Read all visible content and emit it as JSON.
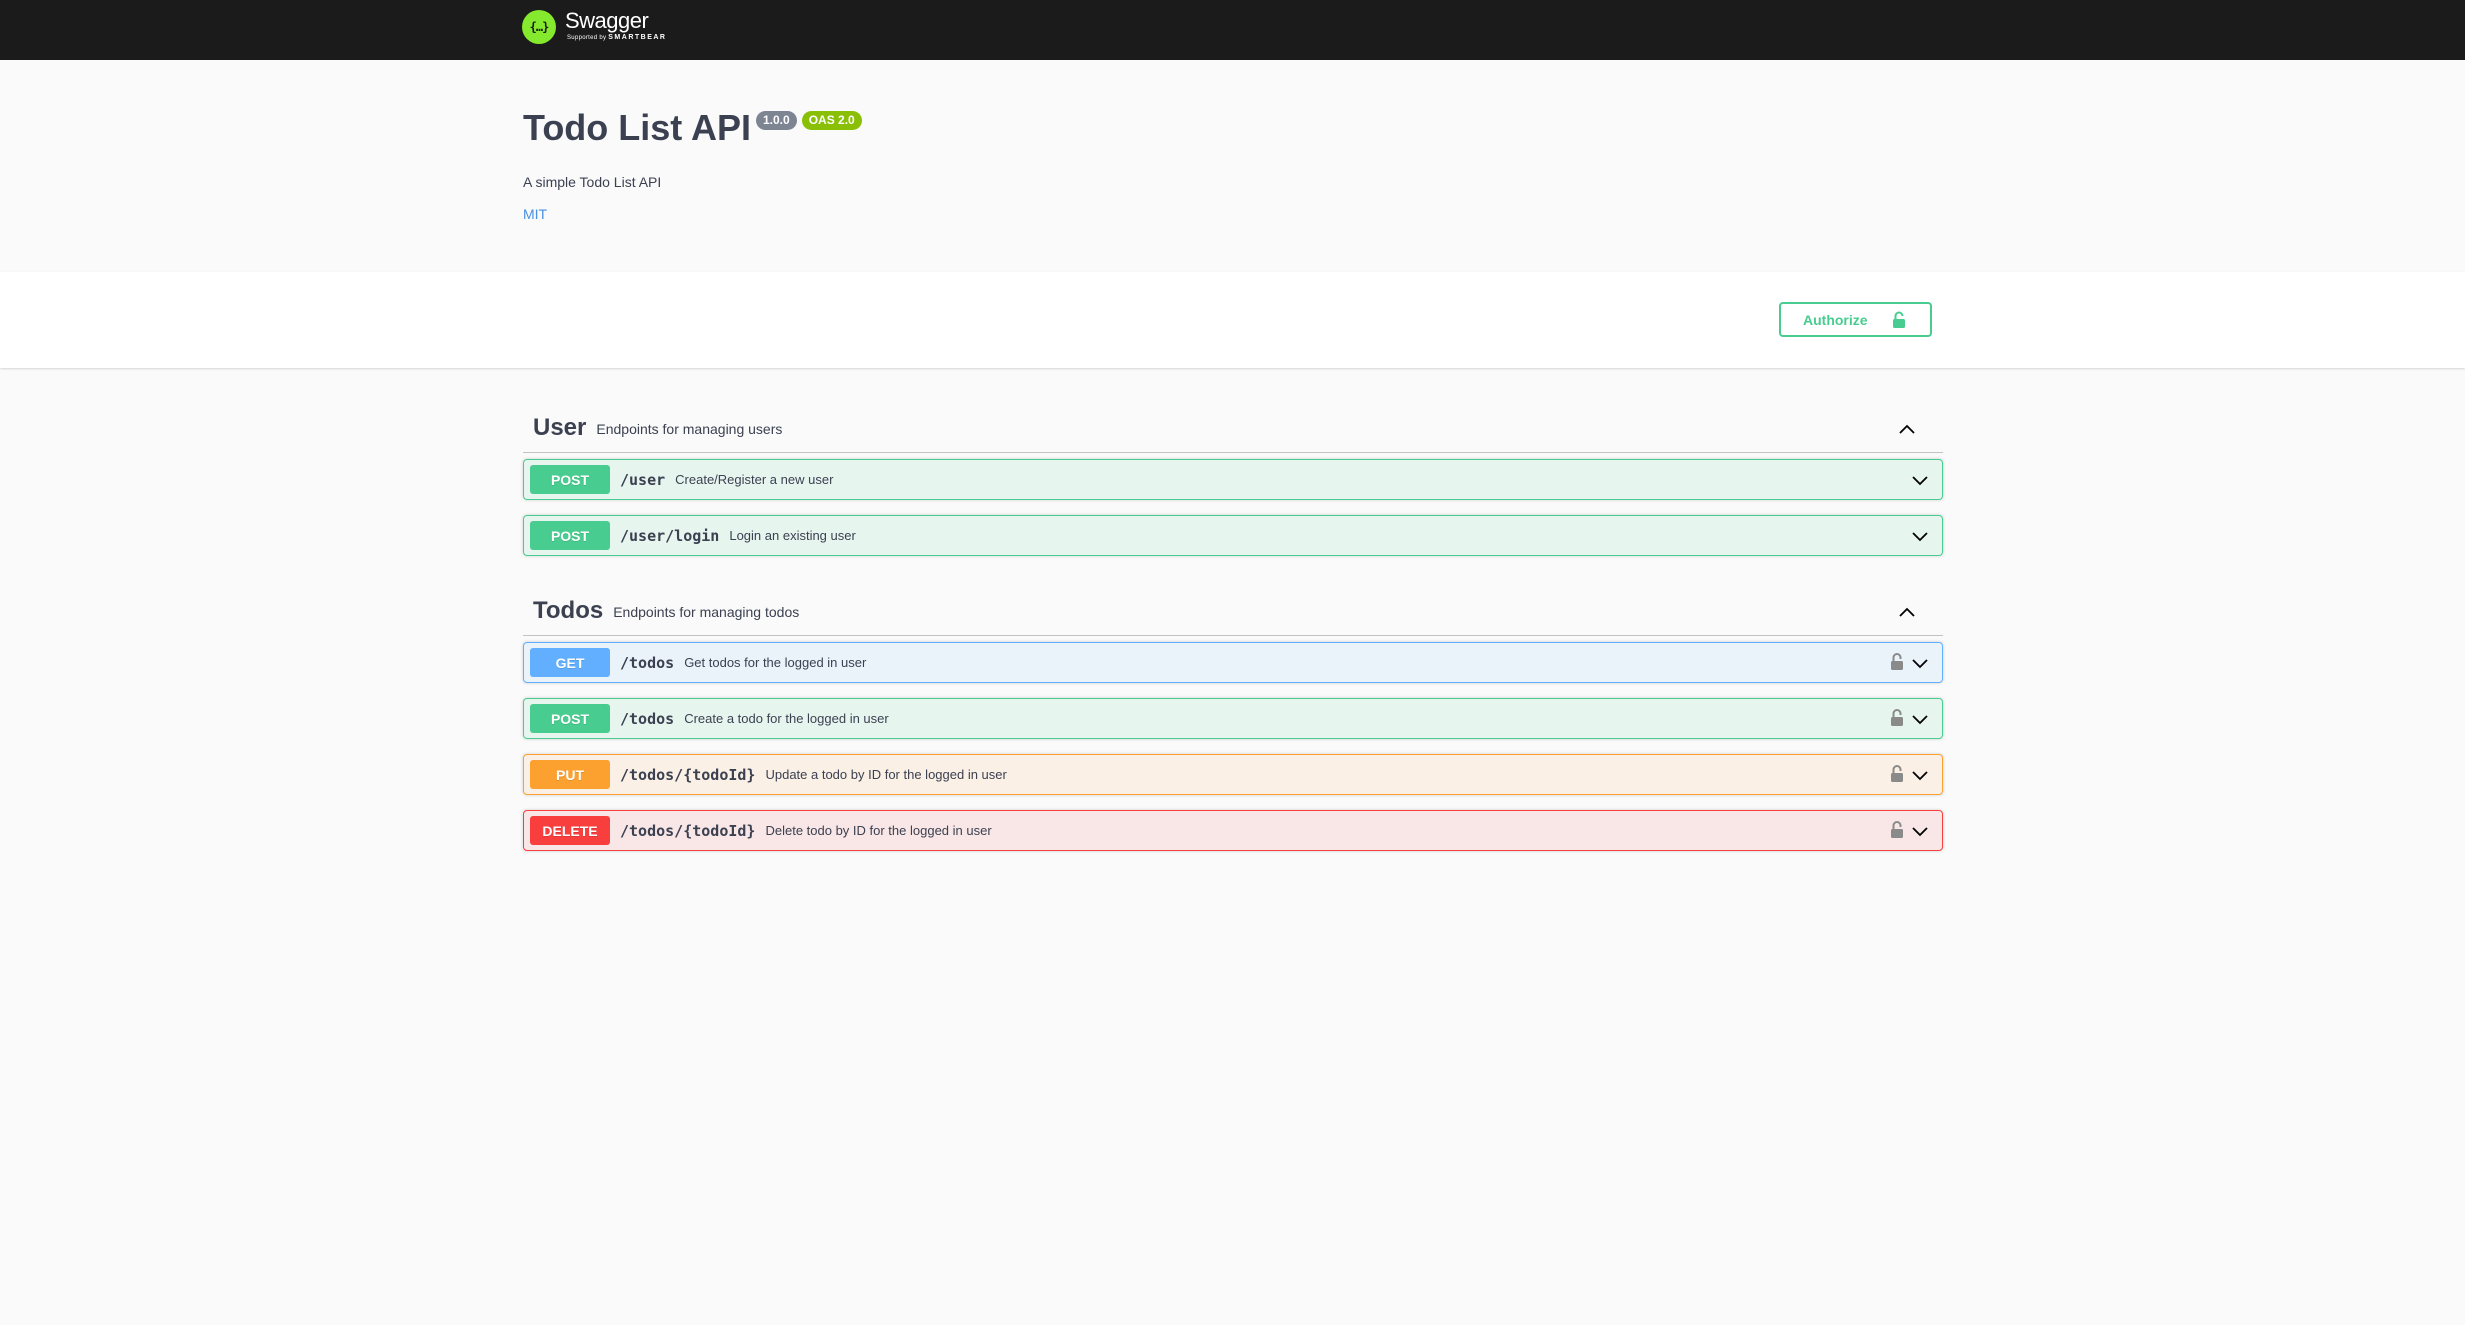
{
  "topbar": {
    "logo_mark": "{…}",
    "logo_name": "Swagger",
    "logo_sub_prefix": "Supported by",
    "logo_sub_brand": "SMARTBEAR"
  },
  "info": {
    "title": "Todo List API",
    "version": "1.0.0",
    "oas_version": "OAS 2.0",
    "description": "A simple Todo List API",
    "license": "MIT"
  },
  "scheme": {
    "authorize_label": "Authorize"
  },
  "colors": {
    "post": "#49cc90",
    "get": "#61affe",
    "put": "#fca130",
    "delete": "#f93e3e",
    "topbar": "#1b1b1b",
    "logo": "#85ea2d"
  },
  "tags": [
    {
      "name": "User",
      "description": "Endpoints for managing users",
      "expanded": true,
      "operations": [
        {
          "method": "POST",
          "path": "/user",
          "summary": "Create/Register a new user",
          "locked": false
        },
        {
          "method": "POST",
          "path": "/user/login",
          "summary": "Login an existing user",
          "locked": false
        }
      ]
    },
    {
      "name": "Todos",
      "description": "Endpoints for managing todos",
      "expanded": true,
      "operations": [
        {
          "method": "GET",
          "path": "/todos",
          "summary": "Get todos for the logged in user",
          "locked": true
        },
        {
          "method": "POST",
          "path": "/todos",
          "summary": "Create a todo for the logged in user",
          "locked": true
        },
        {
          "method": "PUT",
          "path": "/todos/{todoId}",
          "summary": "Update a todo by ID for the logged in user",
          "locked": true
        },
        {
          "method": "DELETE",
          "path": "/todos/{todoId}",
          "summary": "Delete todo by ID for the logged in user",
          "locked": true
        }
      ]
    }
  ]
}
